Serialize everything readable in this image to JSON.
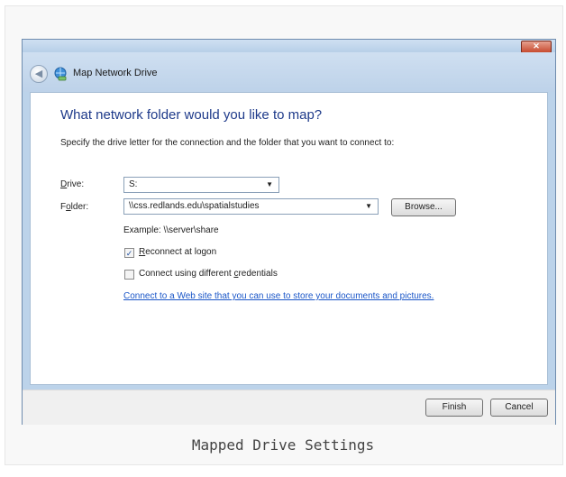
{
  "dialog": {
    "window_title": "Map Network Drive",
    "close_glyph": "✕",
    "back_glyph": "◀",
    "heading": "What network folder would you like to map?",
    "intro": "Specify the drive letter for the connection and the folder that you want to connect to:",
    "drive_label": "Drive:",
    "drive_accel": "D",
    "drive_label_rest": "rive:",
    "drive_value": "S:",
    "folder_label_pre": "F",
    "folder_accel": "o",
    "folder_label_rest": "lder:",
    "folder_value": "\\\\css.redlands.edu\\spatialstudies",
    "browse_label": "Browse...",
    "example": "Example: \\\\server\\share",
    "reconnect_accel": "R",
    "reconnect_rest": "econnect at logon",
    "reconnect_checked": true,
    "credentials_pre": "Connect using different ",
    "credentials_accel": "c",
    "credentials_rest": "redentials",
    "credentials_checked": false,
    "web_link": "Connect to a Web site that you can use to store your documents and pictures.",
    "finish_label": "Finish",
    "cancel_label": "Cancel",
    "check_glyph": "✓",
    "dropdown_glyph": "▼"
  },
  "caption": "Mapped Drive Settings",
  "colors": {
    "heading": "#1e3a8a",
    "link": "#1a56c8",
    "close": "#c74a2f"
  },
  "icons": {
    "back": "back-arrow-icon",
    "app": "network-drive-icon",
    "close": "close-icon",
    "dropdown": "chevron-down-icon"
  }
}
